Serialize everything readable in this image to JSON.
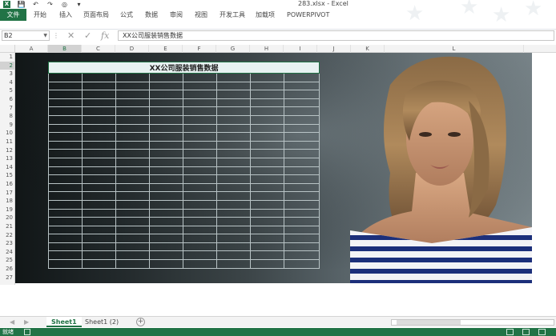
{
  "window": {
    "title": "283.xlsx - Excel",
    "app_icon_letter": "X"
  },
  "quick_access": {
    "save_icon": "save-icon",
    "undo_icon": "undo-icon",
    "redo_icon": "redo-icon",
    "camera_icon": "camera-icon"
  },
  "ribbon": {
    "tabs": [
      "文件",
      "开始",
      "插入",
      "页面布局",
      "公式",
      "数据",
      "审阅",
      "视图",
      "开发工具",
      "加载项",
      "POWERPIVOT"
    ]
  },
  "formula_bar": {
    "name_box": "B2",
    "cancel_glyph": "✕",
    "enter_glyph": "✓",
    "fx_label": "fx",
    "formula": "XX公司服装销售数据"
  },
  "sheet": {
    "columns": [
      "A",
      "B",
      "C",
      "D",
      "E",
      "F",
      "G",
      "H",
      "I",
      "J",
      "K",
      "L"
    ],
    "rows": [
      "1",
      "2",
      "3",
      "4",
      "5",
      "6",
      "7",
      "8",
      "9",
      "10",
      "11",
      "12",
      "13",
      "14",
      "15",
      "16",
      "17",
      "18",
      "19",
      "20",
      "21",
      "22",
      "23",
      "24",
      "25",
      "26",
      "27"
    ],
    "selected_cell": "B2",
    "table_title": "XX公司服装销售数据"
  },
  "sheet_tabs": {
    "tabs": [
      "Sheet1",
      "Sheet1 (2)"
    ],
    "active": "Sheet1",
    "add_label": "+"
  },
  "status": {
    "text": "就绪"
  },
  "colors": {
    "excel_green": "#217346",
    "header_gray": "#f3f3f3"
  }
}
